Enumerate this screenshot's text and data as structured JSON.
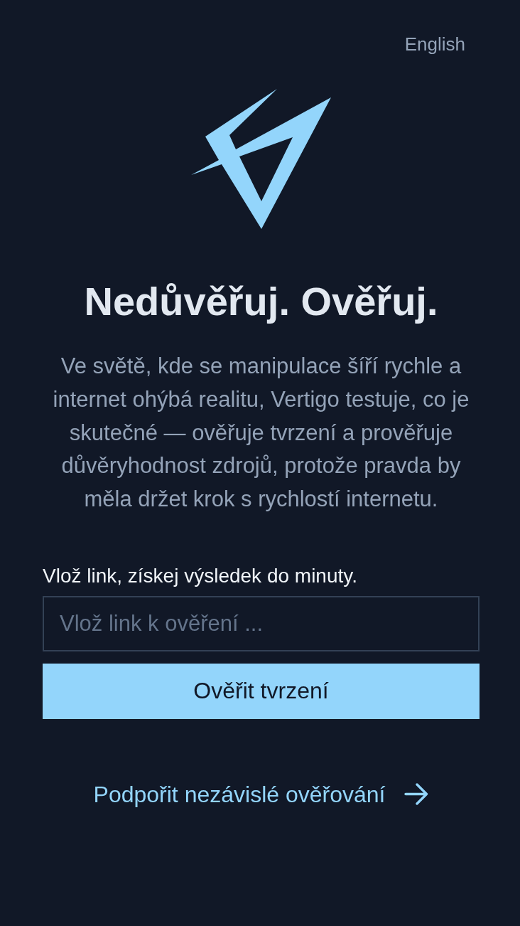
{
  "header": {
    "language_link": "English"
  },
  "hero": {
    "title": "Nedůvěřuj. Ověřuj.",
    "description": "Ve světě, kde se manipulace šíří rychle a internet ohýbá realitu, Vertigo testuje, co je skutečné — ověřuje tvrzení a prověřuje důvěryhodnost zdrojů, protože pravda by měla držet krok s rychlostí internetu."
  },
  "form": {
    "label": "Vlož link, získej výsledek do minuty.",
    "input": {
      "placeholder": "Vlož link k ověření ..."
    },
    "submit_button": "Ověřit tvrzení"
  },
  "support_link": {
    "label": "Podpořit nezávislé ověřování"
  }
}
